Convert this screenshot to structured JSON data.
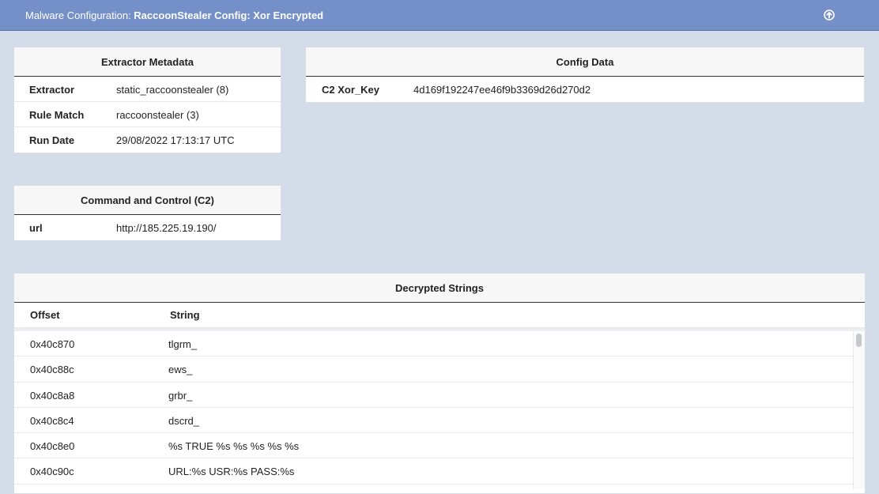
{
  "header": {
    "prefix": "Malware Configuration: ",
    "title": "RaccoonStealer Config: Xor Encrypted"
  },
  "extractor_metadata": {
    "title": "Extractor Metadata",
    "rows": [
      {
        "key": "Extractor",
        "value": "static_raccoonstealer (8)"
      },
      {
        "key": "Rule Match",
        "value": "raccoonstealer (3)"
      },
      {
        "key": "Run Date",
        "value": "29/08/2022 17:13:17 UTC"
      }
    ]
  },
  "config_data": {
    "title": "Config Data",
    "rows": [
      {
        "key": "C2 Xor_Key",
        "value": "4d169f192247ee46f9b3369d26d270d2"
      }
    ]
  },
  "c2": {
    "title": "Command and Control (C2)",
    "rows": [
      {
        "key": "url",
        "value": "http://185.225.19.190/"
      }
    ]
  },
  "decrypted_strings": {
    "title": "Decrypted Strings",
    "columns": [
      "Offset",
      "String"
    ],
    "rows": [
      {
        "offset": "0x40c870",
        "string": "tlgrm_"
      },
      {
        "offset": "0x40c88c",
        "string": "ews_"
      },
      {
        "offset": "0x40c8a8",
        "string": "grbr_"
      },
      {
        "offset": "0x40c8c4",
        "string": "dscrd_"
      },
      {
        "offset": "0x40c8e0",
        "string": "%s TRUE %s %s %s %s %s"
      },
      {
        "offset": "0x40c90c",
        "string": "URL:%s USR:%s PASS:%s"
      }
    ]
  }
}
